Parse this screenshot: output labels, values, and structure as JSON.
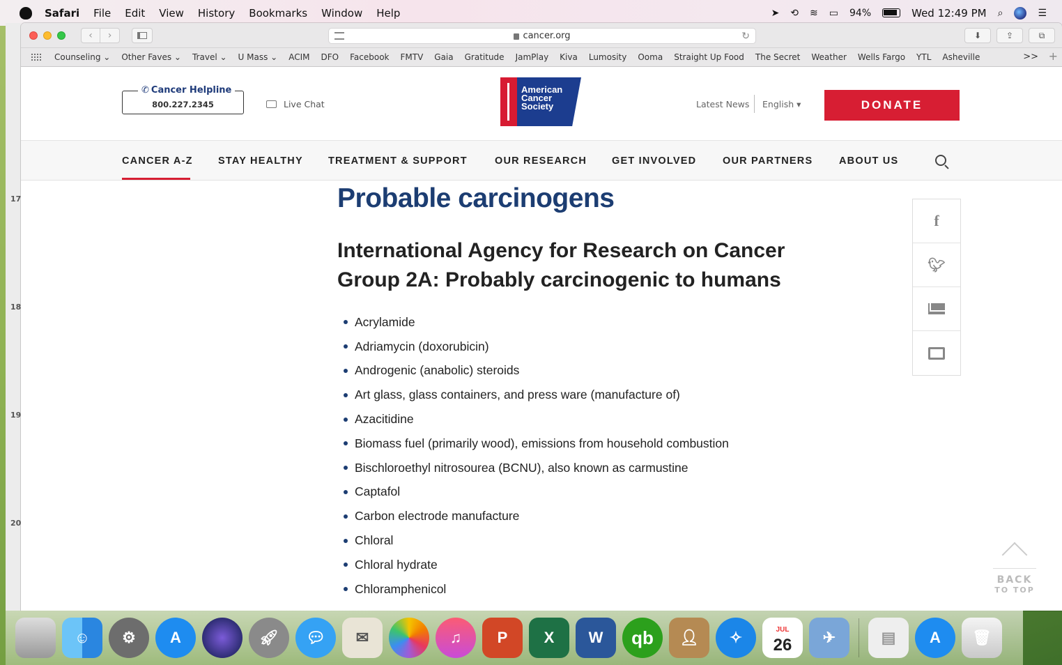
{
  "menubar": {
    "app": "Safari",
    "items": [
      "File",
      "Edit",
      "View",
      "History",
      "Bookmarks",
      "Window",
      "Help"
    ],
    "battery": "94%",
    "clock": "Wed 12:49 PM"
  },
  "browser": {
    "url": "cancer.org",
    "favorites": [
      "Counseling ⌄",
      "Other Faves ⌄",
      "Travel ⌄",
      "U Mass ⌄",
      "ACIM",
      "DFO",
      "Facebook",
      "FMTV",
      "Gaia",
      "Gratitude",
      "JamPlay",
      "Kiva",
      "Lumosity",
      "Ooma",
      "Straight Up Food",
      "The Secret",
      "Weather",
      "Wells Fargo",
      "YTL",
      "Asheville"
    ],
    "more": ">>"
  },
  "site": {
    "helpline_label": "Cancer Helpline",
    "helpline_number": "800.227.2345",
    "live_chat": "Live Chat",
    "logo_lines": [
      "American",
      "Cancer",
      "Society"
    ],
    "latest_news": "Latest News",
    "language": "English ▾",
    "donate": "DONATE",
    "nav": [
      "CANCER A-Z",
      "STAY HEALTHY",
      "TREATMENT & SUPPORT",
      "OUR RESEARCH",
      "GET INVOLVED",
      "OUR PARTNERS",
      "ABOUT US"
    ]
  },
  "content": {
    "title": "Probable carcinogens",
    "subtitle_line1": "International Agency for Research on Cancer",
    "subtitle_line2": "Group 2A: Probably carcinogenic to humans",
    "agents": [
      "Acrylamide",
      "Adriamycin (doxorubicin)",
      "Androgenic (anabolic) steroids",
      "Art glass, glass containers, and press ware (manufacture of)",
      "Azacitidine",
      "Biomass fuel (primarily wood), emissions from household combustion",
      "Bischloroethyl nitrosourea (BCNU), also known as carmustine",
      "Captafol",
      "Carbon electrode manufacture",
      "Chloral",
      "Chloral hydrate",
      "Chloramphenicol"
    ],
    "back_to_top_1": "BACK",
    "back_to_top_2": "TO TOP"
  },
  "sidebar_numbers": [
    "17",
    "18",
    "19",
    "20"
  ],
  "share": [
    "f"
  ],
  "dock": {
    "calendar_month": "JUL",
    "calendar_day": "26"
  }
}
